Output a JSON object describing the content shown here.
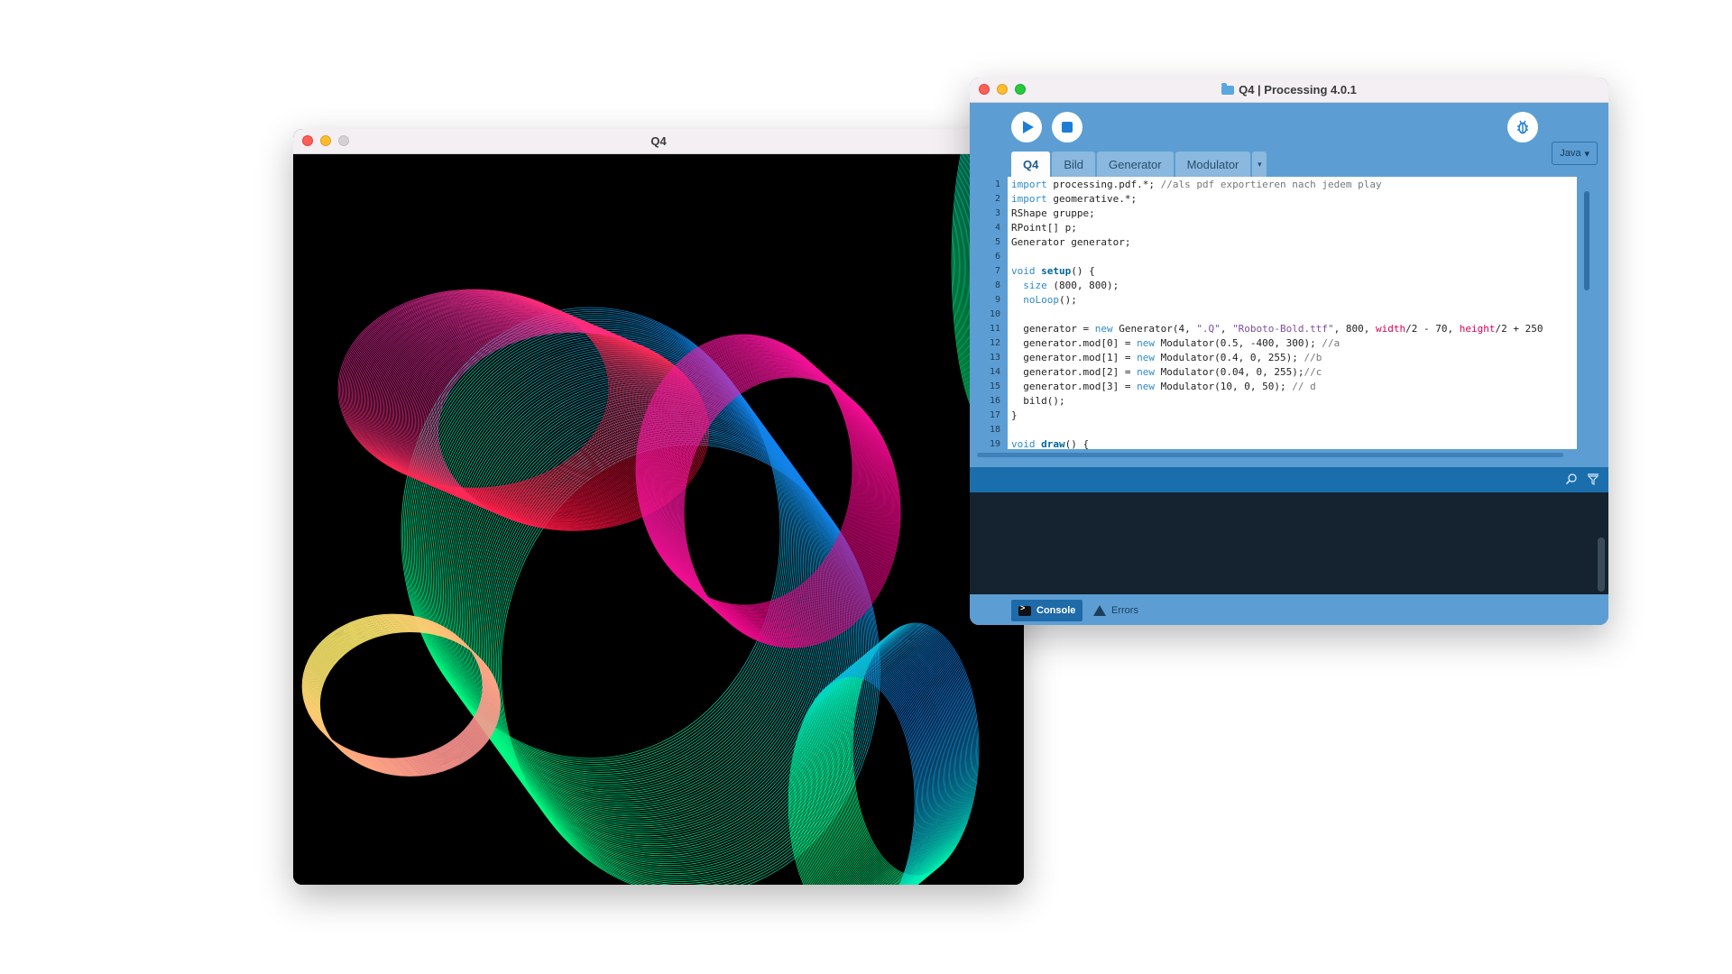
{
  "sketch_window": {
    "title": "Q4"
  },
  "ide_window": {
    "title": "Q4 | Processing 4.0.1",
    "mode_label": "Java",
    "mode_caret": "▾",
    "tabs": [
      {
        "label": "Q4"
      },
      {
        "label": "Bild"
      },
      {
        "label": "Generator"
      },
      {
        "label": "Modulator"
      }
    ],
    "tab_more": "▾",
    "bottom_tabs": {
      "console_label": "Console",
      "errors_label": "Errors"
    },
    "icons": {
      "run": "play-icon",
      "stop": "stop-icon",
      "debug": "debug-icon",
      "search": "search-icon",
      "filter": "filter-icon",
      "folder": "folder-icon"
    }
  },
  "code_lines": [
    {
      "n": "1",
      "html": "<span class='kw'>import</span> processing.pdf.*; <span class='cm'>//als pdf exportieren nach jedem play</span>"
    },
    {
      "n": "2",
      "html": "<span class='kw'>import</span> geomerative.*;"
    },
    {
      "n": "3",
      "html": "RShape gruppe;"
    },
    {
      "n": "4",
      "html": "RPoint[] p;"
    },
    {
      "n": "5",
      "html": "Generator generator;"
    },
    {
      "n": "6",
      "html": ""
    },
    {
      "n": "7",
      "html": "<span class='kw'>void</span> <span class='fn'>setup</span>() {"
    },
    {
      "n": "8",
      "html": "  <span class='bi'>size</span> (800, 800);"
    },
    {
      "n": "9",
      "html": "  <span class='bi'>noLoop</span>();"
    },
    {
      "n": "10",
      "html": ""
    },
    {
      "n": "11",
      "html": "  generator = <span class='kw'>new</span> Generator(4, <span class='str'>\".Q\"</span>, <span class='str'>\"Roboto-Bold.ttf\"</span>, 800, <span class='pk'>width</span>/2 - 70, <span class='pk'>height</span>/2 + 250"
    },
    {
      "n": "12",
      "html": "  generator.mod[0] = <span class='kw'>new</span> Modulator(0.5, -400, 300); <span class='cm'>//a</span>"
    },
    {
      "n": "13",
      "html": "  generator.mod[1] = <span class='kw'>new</span> Modulator(0.4, 0, 255); <span class='cm'>//b</span>"
    },
    {
      "n": "14",
      "html": "  generator.mod[2] = <span class='kw'>new</span> Modulator(0.04, 0, 255);<span class='cm'>//c</span>"
    },
    {
      "n": "15",
      "html": "  generator.mod[3] = <span class='kw'>new</span> Modulator(10, 0, 50); <span class='cm'>// d</span>"
    },
    {
      "n": "16",
      "html": "  bild();"
    },
    {
      "n": "17",
      "html": "}"
    },
    {
      "n": "18",
      "html": ""
    },
    {
      "n": "19",
      "html": "<span class='kw'>void</span> <span class='fn'>draw</span>() {"
    }
  ],
  "colors": {
    "ide_blue": "#5c9ed3",
    "status_blue": "#1a6eac",
    "console_bg": "#14232f",
    "canvas_bg": "#000000"
  }
}
